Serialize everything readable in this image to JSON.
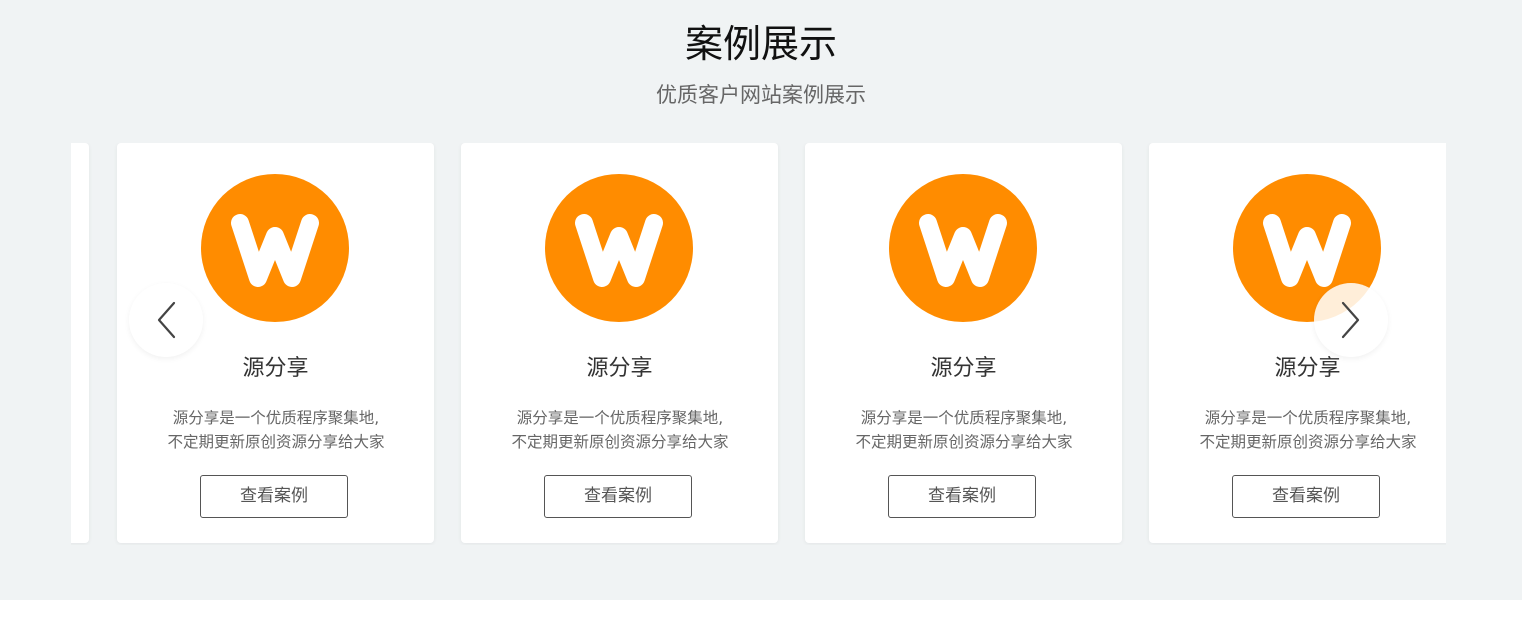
{
  "section": {
    "title": "案例展示",
    "subtitle": "优质客户网站案例展示"
  },
  "cards": [
    {
      "title": "源分享",
      "desc_line1": "源分享是一个优质程序聚集地,",
      "desc_line2": "不定期更新原创资源分享给大家",
      "button": "查看案例",
      "logo_letter": "W"
    },
    {
      "title": "源分享",
      "desc_line1": "源分享是一个优质程序聚集地,",
      "desc_line2": "不定期更新原创资源分享给大家",
      "button": "查看案例",
      "logo_letter": "W"
    },
    {
      "title": "源分享",
      "desc_line1": "源分享是一个优质程序聚集地,",
      "desc_line2": "不定期更新原创资源分享给大家",
      "button": "查看案例",
      "logo_letter": "W"
    },
    {
      "title": "源分享",
      "desc_line1": "源分享是一个优质程序聚集地,",
      "desc_line2": "不定期更新原创资源分享给大家",
      "button": "查看案例",
      "logo_letter": "W"
    }
  ],
  "icons": {
    "prev": "chevron-left-icon",
    "next": "chevron-right-icon",
    "logo": "w-logo-icon"
  },
  "colors": {
    "brand_orange": "#ff8c00",
    "section_bg": "#f0f3f4",
    "card_bg": "#ffffff"
  }
}
